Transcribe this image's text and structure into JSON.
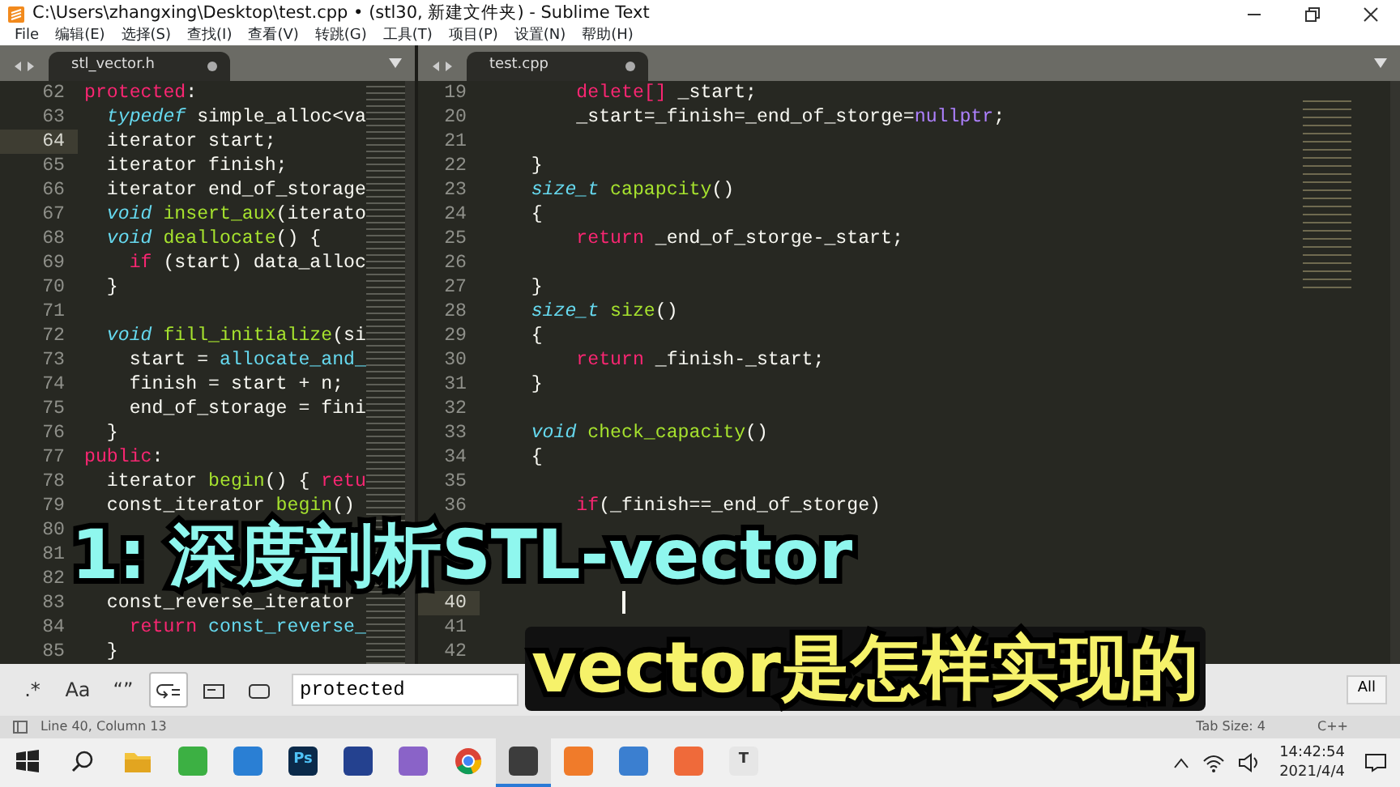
{
  "window": {
    "title": "C:\\Users\\zhangxing\\Desktop\\test.cpp • (stl30, 新建文件夹) - Sublime Text"
  },
  "menu": [
    "File",
    "编辑(E)",
    "选择(S)",
    "查找(I)",
    "查看(V)",
    "转跳(G)",
    "工具(T)",
    "项目(P)",
    "设置(N)",
    "帮助(H)"
  ],
  "panes": [
    {
      "tab": {
        "label": "stl_vector.h",
        "modified": true
      },
      "lines": [
        {
          "n": "62",
          "current": false,
          "spans": [
            {
              "text": "protected",
              "kind": "kw"
            },
            {
              "text": ":",
              "kind": "plain"
            }
          ]
        },
        {
          "n": "63",
          "current": false,
          "spans": [
            {
              "text": "  typedef",
              "kind": "type"
            },
            {
              "text": " simple_alloc<va",
              "kind": "plain"
            }
          ]
        },
        {
          "n": "64",
          "current": true,
          "spans": [
            {
              "text": "  iterator start;",
              "kind": "plain"
            }
          ]
        },
        {
          "n": "65",
          "current": false,
          "spans": [
            {
              "text": "  iterator finish;",
              "kind": "plain"
            }
          ]
        },
        {
          "n": "66",
          "current": false,
          "spans": [
            {
              "text": "  iterator end_of_storage",
              "kind": "plain"
            }
          ]
        },
        {
          "n": "67",
          "current": false,
          "spans": [
            {
              "text": "  void",
              "kind": "type"
            },
            {
              "text": " insert_aux",
              "kind": "fn"
            },
            {
              "text": "(iterato",
              "kind": "plain"
            }
          ]
        },
        {
          "n": "68",
          "current": false,
          "spans": [
            {
              "text": "  void",
              "kind": "type"
            },
            {
              "text": " deallocate",
              "kind": "fn"
            },
            {
              "text": "() {",
              "kind": "plain"
            }
          ]
        },
        {
          "n": "69",
          "current": false,
          "spans": [
            {
              "text": "    if",
              "kind": "kw"
            },
            {
              "text": " (start) data_alloc",
              "kind": "plain"
            }
          ]
        },
        {
          "n": "70",
          "current": false,
          "spans": [
            {
              "text": "  }",
              "kind": "plain"
            }
          ]
        },
        {
          "n": "71",
          "current": false
        },
        {
          "n": "72",
          "current": false,
          "spans": [
            {
              "text": "  void",
              "kind": "type"
            },
            {
              "text": " fill_initialize",
              "kind": "fn"
            },
            {
              "text": "(si",
              "kind": "plain"
            }
          ]
        },
        {
          "n": "73",
          "current": false,
          "spans": [
            {
              "text": "    start = ",
              "kind": "plain"
            },
            {
              "text": "allocate_and_",
              "kind": "call"
            }
          ]
        },
        {
          "n": "74",
          "current": false,
          "spans": [
            {
              "text": "    finish = start + n;",
              "kind": "plain"
            }
          ]
        },
        {
          "n": "75",
          "current": false,
          "spans": [
            {
              "text": "    end_of_storage = fini",
              "kind": "plain"
            }
          ]
        },
        {
          "n": "76",
          "current": false,
          "spans": [
            {
              "text": "  }",
              "kind": "plain"
            }
          ]
        },
        {
          "n": "77",
          "current": false,
          "spans": [
            {
              "text": "public",
              "kind": "kw"
            },
            {
              "text": ":",
              "kind": "plain"
            }
          ]
        },
        {
          "n": "78",
          "current": false,
          "spans": [
            {
              "text": "  iterator",
              "kind": "plain"
            },
            {
              "text": " begin",
              "kind": "fn"
            },
            {
              "text": "() {",
              "kind": "plain"
            },
            {
              "text": " retu",
              "kind": "kw"
            }
          ]
        },
        {
          "n": "79",
          "current": false,
          "spans": [
            {
              "text": "  const_iterator",
              "kind": "plain"
            },
            {
              "text": " begin",
              "kind": "fn"
            },
            {
              "text": "()",
              "kind": "plain"
            }
          ]
        },
        {
          "n": "80",
          "current": false
        },
        {
          "n": "81",
          "current": false
        },
        {
          "n": "82",
          "current": false
        },
        {
          "n": "83",
          "current": false,
          "spans": [
            {
              "text": "  const_reverse_iterator",
              "kind": "plain"
            }
          ]
        },
        {
          "n": "84",
          "current": false,
          "spans": [
            {
              "text": "    return",
              "kind": "kw"
            },
            {
              "text": " const_reverse_",
              "kind": "call"
            }
          ]
        },
        {
          "n": "85",
          "current": false,
          "spans": [
            {
              "text": "  }",
              "kind": "plain"
            }
          ]
        }
      ]
    },
    {
      "tab": {
        "label": "test.cpp",
        "modified": true
      },
      "lines": [
        {
          "n": "19",
          "current": false,
          "spans": [
            {
              "text": "        delete[]",
              "kind": "kw"
            },
            {
              "text": " _start;",
              "kind": "plain"
            }
          ]
        },
        {
          "n": "20",
          "current": false,
          "spans": [
            {
              "text": "        _start=_finish=_end_of_storge=",
              "kind": "plain"
            },
            {
              "text": "nullptr",
              "kind": "const"
            },
            {
              "text": ";",
              "kind": "plain"
            }
          ]
        },
        {
          "n": "21",
          "current": false
        },
        {
          "n": "22",
          "current": false,
          "spans": [
            {
              "text": "    }",
              "kind": "plain"
            }
          ]
        },
        {
          "n": "23",
          "current": false,
          "spans": [
            {
              "text": "    size_t",
              "kind": "type"
            },
            {
              "text": " capapcity",
              "kind": "fn"
            },
            {
              "text": "()",
              "kind": "plain"
            }
          ]
        },
        {
          "n": "24",
          "current": false,
          "spans": [
            {
              "text": "    {",
              "kind": "plain"
            }
          ]
        },
        {
          "n": "25",
          "current": false,
          "spans": [
            {
              "text": "        return",
              "kind": "kw"
            },
            {
              "text": " _end_of_storge-_start;",
              "kind": "plain"
            }
          ]
        },
        {
          "n": "26",
          "current": false
        },
        {
          "n": "27",
          "current": false,
          "spans": [
            {
              "text": "    }",
              "kind": "plain"
            }
          ]
        },
        {
          "n": "28",
          "current": false,
          "spans": [
            {
              "text": "    size_t",
              "kind": "type"
            },
            {
              "text": " size",
              "kind": "fn"
            },
            {
              "text": "()",
              "kind": "plain"
            }
          ]
        },
        {
          "n": "29",
          "current": false,
          "spans": [
            {
              "text": "    {",
              "kind": "plain"
            }
          ]
        },
        {
          "n": "30",
          "current": false,
          "spans": [
            {
              "text": "        return",
              "kind": "kw"
            },
            {
              "text": " _finish-_start;",
              "kind": "plain"
            }
          ]
        },
        {
          "n": "31",
          "current": false,
          "spans": [
            {
              "text": "    }",
              "kind": "plain"
            }
          ]
        },
        {
          "n": "32",
          "current": false
        },
        {
          "n": "33",
          "current": false,
          "spans": [
            {
              "text": "    void",
              "kind": "type"
            },
            {
              "text": " check_capacity",
              "kind": "fn"
            },
            {
              "text": "()",
              "kind": "plain"
            }
          ]
        },
        {
          "n": "34",
          "current": false,
          "spans": [
            {
              "text": "    {",
              "kind": "plain"
            }
          ]
        },
        {
          "n": "35",
          "current": false
        },
        {
          "n": "36",
          "current": false,
          "spans": [
            {
              "text": "        if",
              "kind": "kw"
            },
            {
              "text": "(_finish==_end_of_storge)",
              "kind": "plain"
            }
          ]
        },
        {
          "current": false
        },
        {
          "current": false
        },
        {
          "current": false
        },
        {
          "n": "40",
          "current": true,
          "cursor": true
        },
        {
          "n": "41",
          "current": false
        },
        {
          "n": "42",
          "current": false
        }
      ]
    }
  ],
  "find_bar": {
    "options": [
      {
        "kind": "text",
        "label": ".*",
        "on": false
      },
      {
        "kind": "text",
        "label": "Aa",
        "on": false
      },
      {
        "kind": "text",
        "label": "“”",
        "on": false
      },
      {
        "kind": "wrap",
        "on": true
      },
      {
        "kind": "selection",
        "on": false
      },
      {
        "kind": "highlight",
        "on": false
      }
    ],
    "value": "protected",
    "button": "All"
  },
  "status_bar": {
    "position": "Line 40, Column 13",
    "tab_size": "Tab Size: 4",
    "syntax": "C++"
  },
  "taskbar": {
    "apps": [
      {
        "kind": "folder",
        "selected": false
      },
      {
        "kind": "tile",
        "color": "#3cb043",
        "selected": false
      },
      {
        "kind": "tile",
        "color": "#2a7fd4",
        "selected": false
      },
      {
        "kind": "tile",
        "color": "#0b2a4a",
        "label": "Ps",
        "selected": false
      },
      {
        "kind": "tile",
        "color": "#24418f",
        "selected": false
      },
      {
        "kind": "tile",
        "color": "#8a63c8",
        "selected": false
      },
      {
        "kind": "chrome",
        "selected": false
      },
      {
        "kind": "tile",
        "color": "#3c3c3c",
        "selected": true
      },
      {
        "kind": "tile",
        "color": "#f07b2a",
        "selected": false
      },
      {
        "kind": "tile",
        "color": "#3b7fd0",
        "selected": false
      },
      {
        "kind": "tile",
        "color": "#ef6a3a",
        "selected": false
      },
      {
        "kind": "tile",
        "color": "#e6e6e6",
        "label": "T",
        "selected": false
      }
    ],
    "time": "14:42:54",
    "date": "2021/4/4"
  },
  "overlay": {
    "headline": "1: 深度剖析STL-vector",
    "subtitle": "vector是怎样实现的"
  }
}
